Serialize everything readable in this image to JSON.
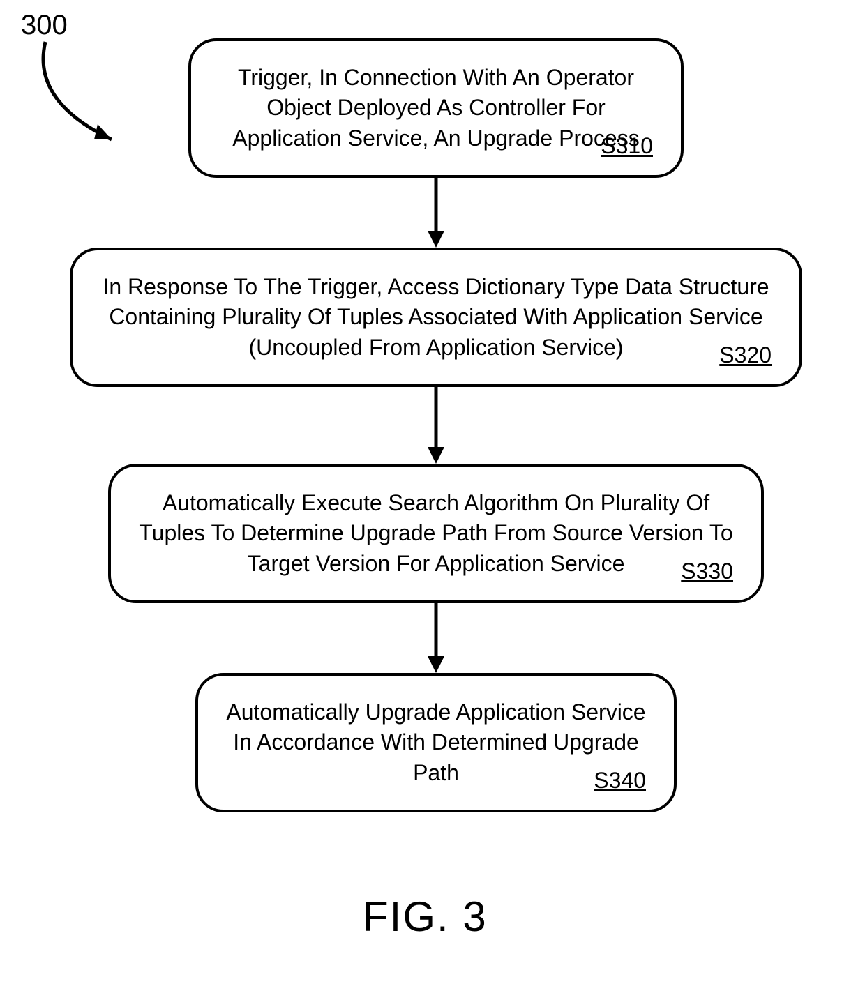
{
  "ref_number": "300",
  "steps": [
    {
      "id": "S310",
      "text": "Trigger, In Connection With An Operator Object Deployed As Controller For Application Service, An Upgrade Process"
    },
    {
      "id": "S320",
      "text": "In Response To The Trigger, Access Dictionary Type Data Structure Containing Plurality Of Tuples Associated With Application Service (Uncoupled From Application Service)"
    },
    {
      "id": "S330",
      "text": "Automatically Execute Search Algorithm On Plurality Of Tuples To Determine Upgrade Path From Source Version To Target Version For Application Service"
    },
    {
      "id": "S340",
      "text": "Automatically Upgrade Application Service In Accordance With Determined Upgrade Path"
    }
  ],
  "figure_caption": "FIG. 3"
}
